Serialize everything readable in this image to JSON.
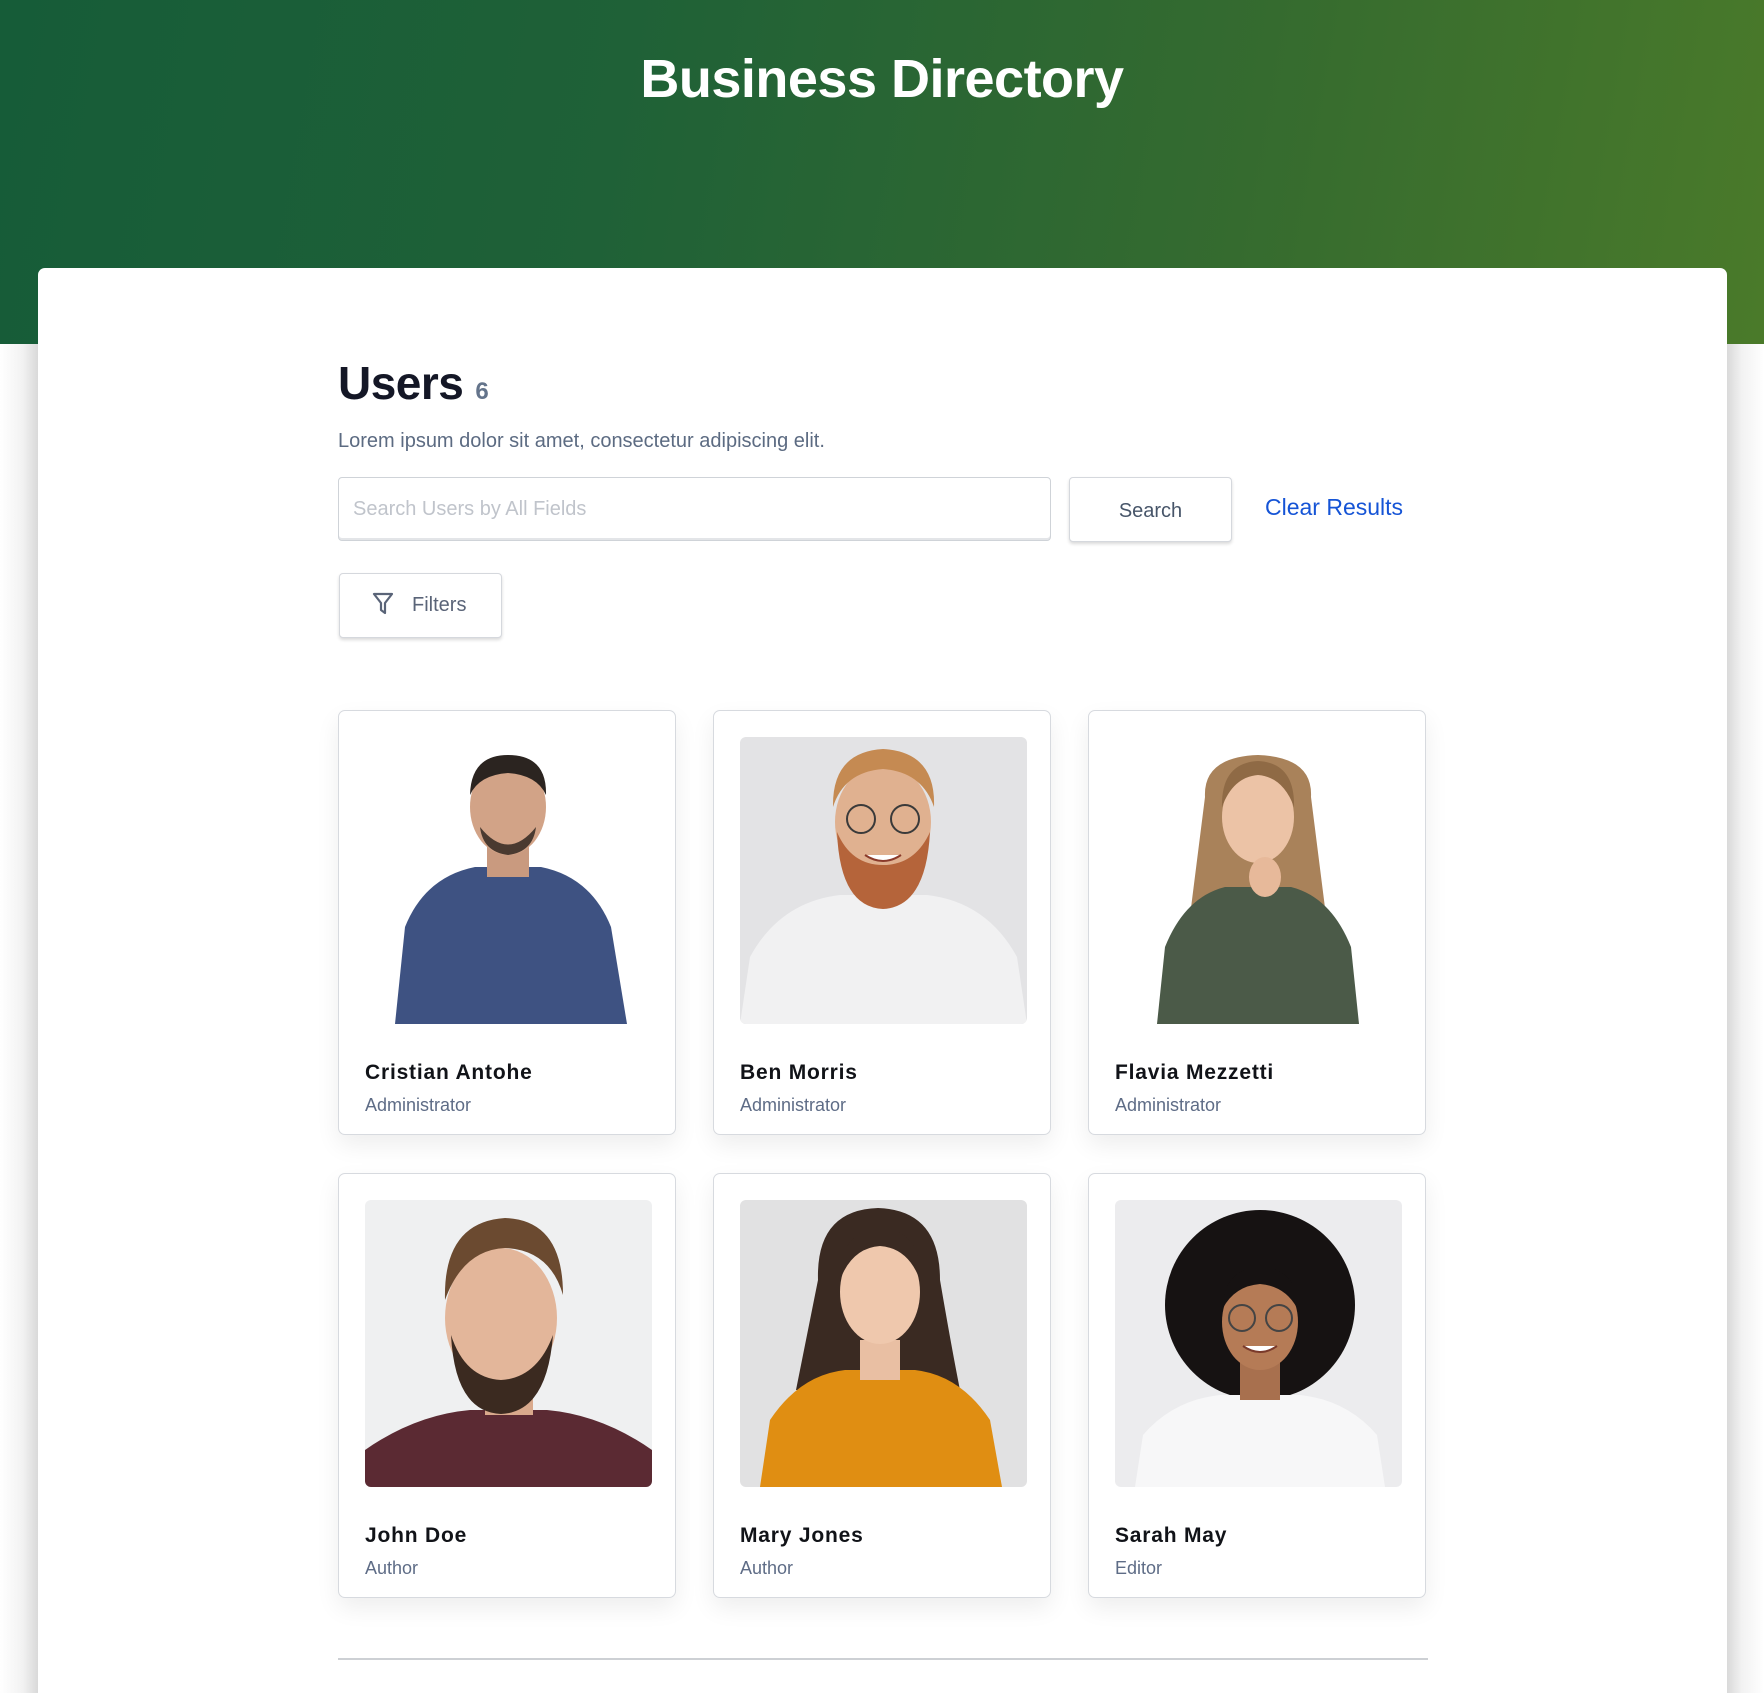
{
  "header": {
    "title": "Business Directory",
    "gradient_colors": [
      "#165c38",
      "#4a7a2a"
    ]
  },
  "users_section": {
    "title": "Users",
    "count": "6",
    "subtitle": "Lorem ipsum dolor sit amet, consectetur adipiscing elit."
  },
  "search": {
    "value": "",
    "placeholder": "Search Users by All Fields",
    "button_label": "Search",
    "clear_label": "Clear Results",
    "link_color": "#1554d6"
  },
  "filters": {
    "label": "Filters",
    "icon": "filter-funnel-icon"
  },
  "users": [
    {
      "name": "Cristian Antohe",
      "role": "Administrator",
      "photo": "man-navy-tshirt-white-background"
    },
    {
      "name": "Ben Morris",
      "role": "Administrator",
      "photo": "redhead-bearded-man-glasses-white-tshirt"
    },
    {
      "name": "Flavia Mezzetti",
      "role": "Administrator",
      "photo": "woman-long-hair-green-blouse"
    },
    {
      "name": "John Doe",
      "role": "Author",
      "photo": "bearded-man-maroon-tshirt"
    },
    {
      "name": "Mary Jones",
      "role": "Author",
      "photo": "woman-wavy-hair-orange-top"
    },
    {
      "name": "Sarah May",
      "role": "Editor",
      "photo": "woman-curly-hair-glasses-white-tshirt"
    }
  ]
}
